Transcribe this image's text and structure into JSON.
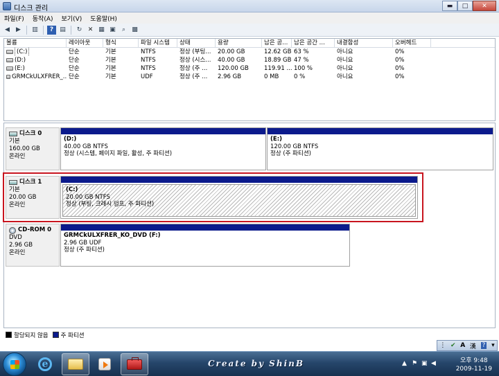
{
  "window": {
    "title": "디스크 관리",
    "buttons": {
      "minimize": "▬",
      "maximize": "□",
      "close": "✕"
    }
  },
  "menu": [
    "파일(F)",
    "동작(A)",
    "보기(V)",
    "도움말(H)"
  ],
  "toolbar_icons": [
    "back-icon",
    "forward-icon",
    "show-hide-console-tree-icon",
    "help-icon",
    "show-hide-action-pane-icon",
    "refresh-icon",
    "delete-icon",
    "properties-icon",
    "open-icon",
    "search-icon",
    "settings-icon"
  ],
  "volume_list": {
    "columns": [
      "볼륨",
      "레이아웃",
      "형식",
      "파일 시스템",
      "상태",
      "용량",
      "남은 공...",
      "남은 공간 ...",
      "내결함성",
      "오버헤드"
    ],
    "rows": [
      [
        "(C:)",
        "단순",
        "기본",
        "NTFS",
        "정상 (부팅...",
        "20.00 GB",
        "12.62 GB",
        "63 %",
        "아니요",
        "0%"
      ],
      [
        "(D:)",
        "단순",
        "기본",
        "NTFS",
        "정상 (시스...",
        "40.00 GB",
        "18.89 GB",
        "47 %",
        "아니요",
        "0%"
      ],
      [
        "(E:)",
        "단순",
        "기본",
        "NTFS",
        "정상 (주 ...",
        "120.00 GB",
        "119.91 ...",
        "100 %",
        "아니요",
        "0%"
      ],
      [
        "GRMCkULXFRER_...",
        "단순",
        "기본",
        "UDF",
        "정상 (주 ...",
        "2.96 GB",
        "0 MB",
        "0 %",
        "아니요",
        "0%"
      ]
    ]
  },
  "disks": [
    {
      "name": "디스크 0",
      "type": "기본",
      "size": "160.00 GB",
      "status": "온라인",
      "partitions": [
        {
          "name": "(D:)",
          "info": "40.00 GB NTFS",
          "status": "정상 (시스템, 페이지 파일, 활성, 주 파티션)"
        },
        {
          "name": "(E:)",
          "info": "120.00 GB NTFS",
          "status": "정상 (주 파티션)"
        }
      ]
    },
    {
      "name": "디스크 1",
      "type": "기본",
      "size": "20.00 GB",
      "status": "온라인",
      "partitions": [
        {
          "name": "(C:)",
          "info": "20.00 GB NTFS",
          "status": "정상 (부팅, 크래시 덤프, 주 파티션)"
        }
      ]
    },
    {
      "name": "CD-ROM 0",
      "type": "DVD",
      "size": "2.96 GB",
      "status": "온라인",
      "partitions": [
        {
          "name": "GRMCkULXFRER_KO_DVD  (F:)",
          "info": "2.96 GB UDF",
          "status": "정상 (주 파티션)"
        }
      ]
    }
  ],
  "legend": [
    {
      "label": "할당되지 않음",
      "color": "#000000"
    },
    {
      "label": "주 파티션",
      "color": "#0b1a8c"
    }
  ],
  "language_bar": {
    "ime": "A",
    "mode": "漢"
  },
  "taskbar": {
    "signature": "Create by ShinB",
    "time": "오후 9:48",
    "date": "2009-11-19"
  },
  "colors": {
    "primary_partition": "#0b1a8c",
    "highlight": "#c8141e"
  }
}
